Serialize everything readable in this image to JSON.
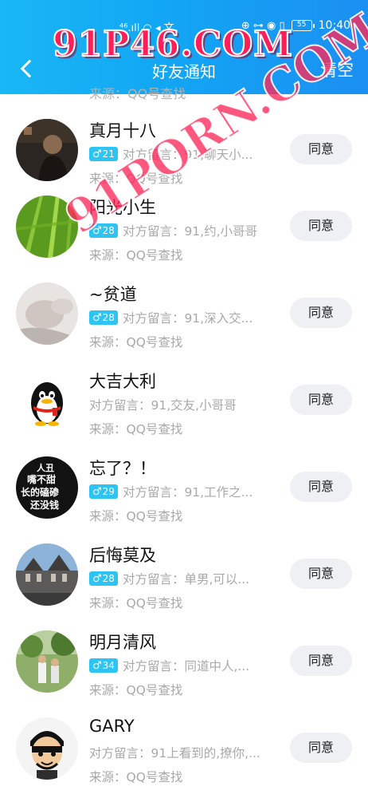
{
  "status_bar": {
    "left_glyphs": "⁴⁶.ıll  ◠  ◂  文",
    "right_glyphs": "⊕  ⊶  ◉  ▯",
    "battery": "55",
    "time": "10:40"
  },
  "header": {
    "title": "好友通知",
    "clear_label": "清空"
  },
  "watermarks": {
    "top": "91P46.COM",
    "diagonal": "91PORN.COM"
  },
  "partial_row_text": "来源：QQ号查找",
  "agree_label": "同意",
  "requests": [
    {
      "name": "真月十八",
      "age": "21",
      "message": "对方留言：91,聊天小...",
      "source": "来源：QQ号查找"
    },
    {
      "name": "阳光小生",
      "age": "28",
      "message": "对方留言：91,约,小哥哥",
      "source": "来源：QQ号查找"
    },
    {
      "name": "~贫道",
      "age": "28",
      "message": "对方留言：91,深入交...",
      "source": "来源：QQ号查找"
    },
    {
      "name": "大吉大利",
      "age": "",
      "message": "对方留言：91,交友,小哥哥",
      "source": "来源：QQ号查找"
    },
    {
      "name": "忘了？！",
      "age": "29",
      "message": "对方留言：91,工作之...",
      "source": "来源：QQ号查找"
    },
    {
      "name": "后悔莫及",
      "age": "28",
      "message": "对方留言：单男,可以...",
      "source": "来源：QQ号查找"
    },
    {
      "name": "明月清风",
      "age": "34",
      "message": "对方留言：同道中人,...",
      "source": "来源：QQ号查找"
    },
    {
      "name": "GARY",
      "age": "",
      "message": "对方留言：91上看到的,撩你,...",
      "source": "来源：QQ号查找"
    }
  ],
  "avatar_texts": {
    "row5": [
      "人丑",
      "嘴不甜",
      "长的磕碜",
      "还没钱"
    ]
  },
  "colors": {
    "header_gradient_start": "#19b7f5",
    "header_gradient_end": "#1b8ff2",
    "badge": "#2dc3f2",
    "button_bg": "#eef0f4"
  }
}
